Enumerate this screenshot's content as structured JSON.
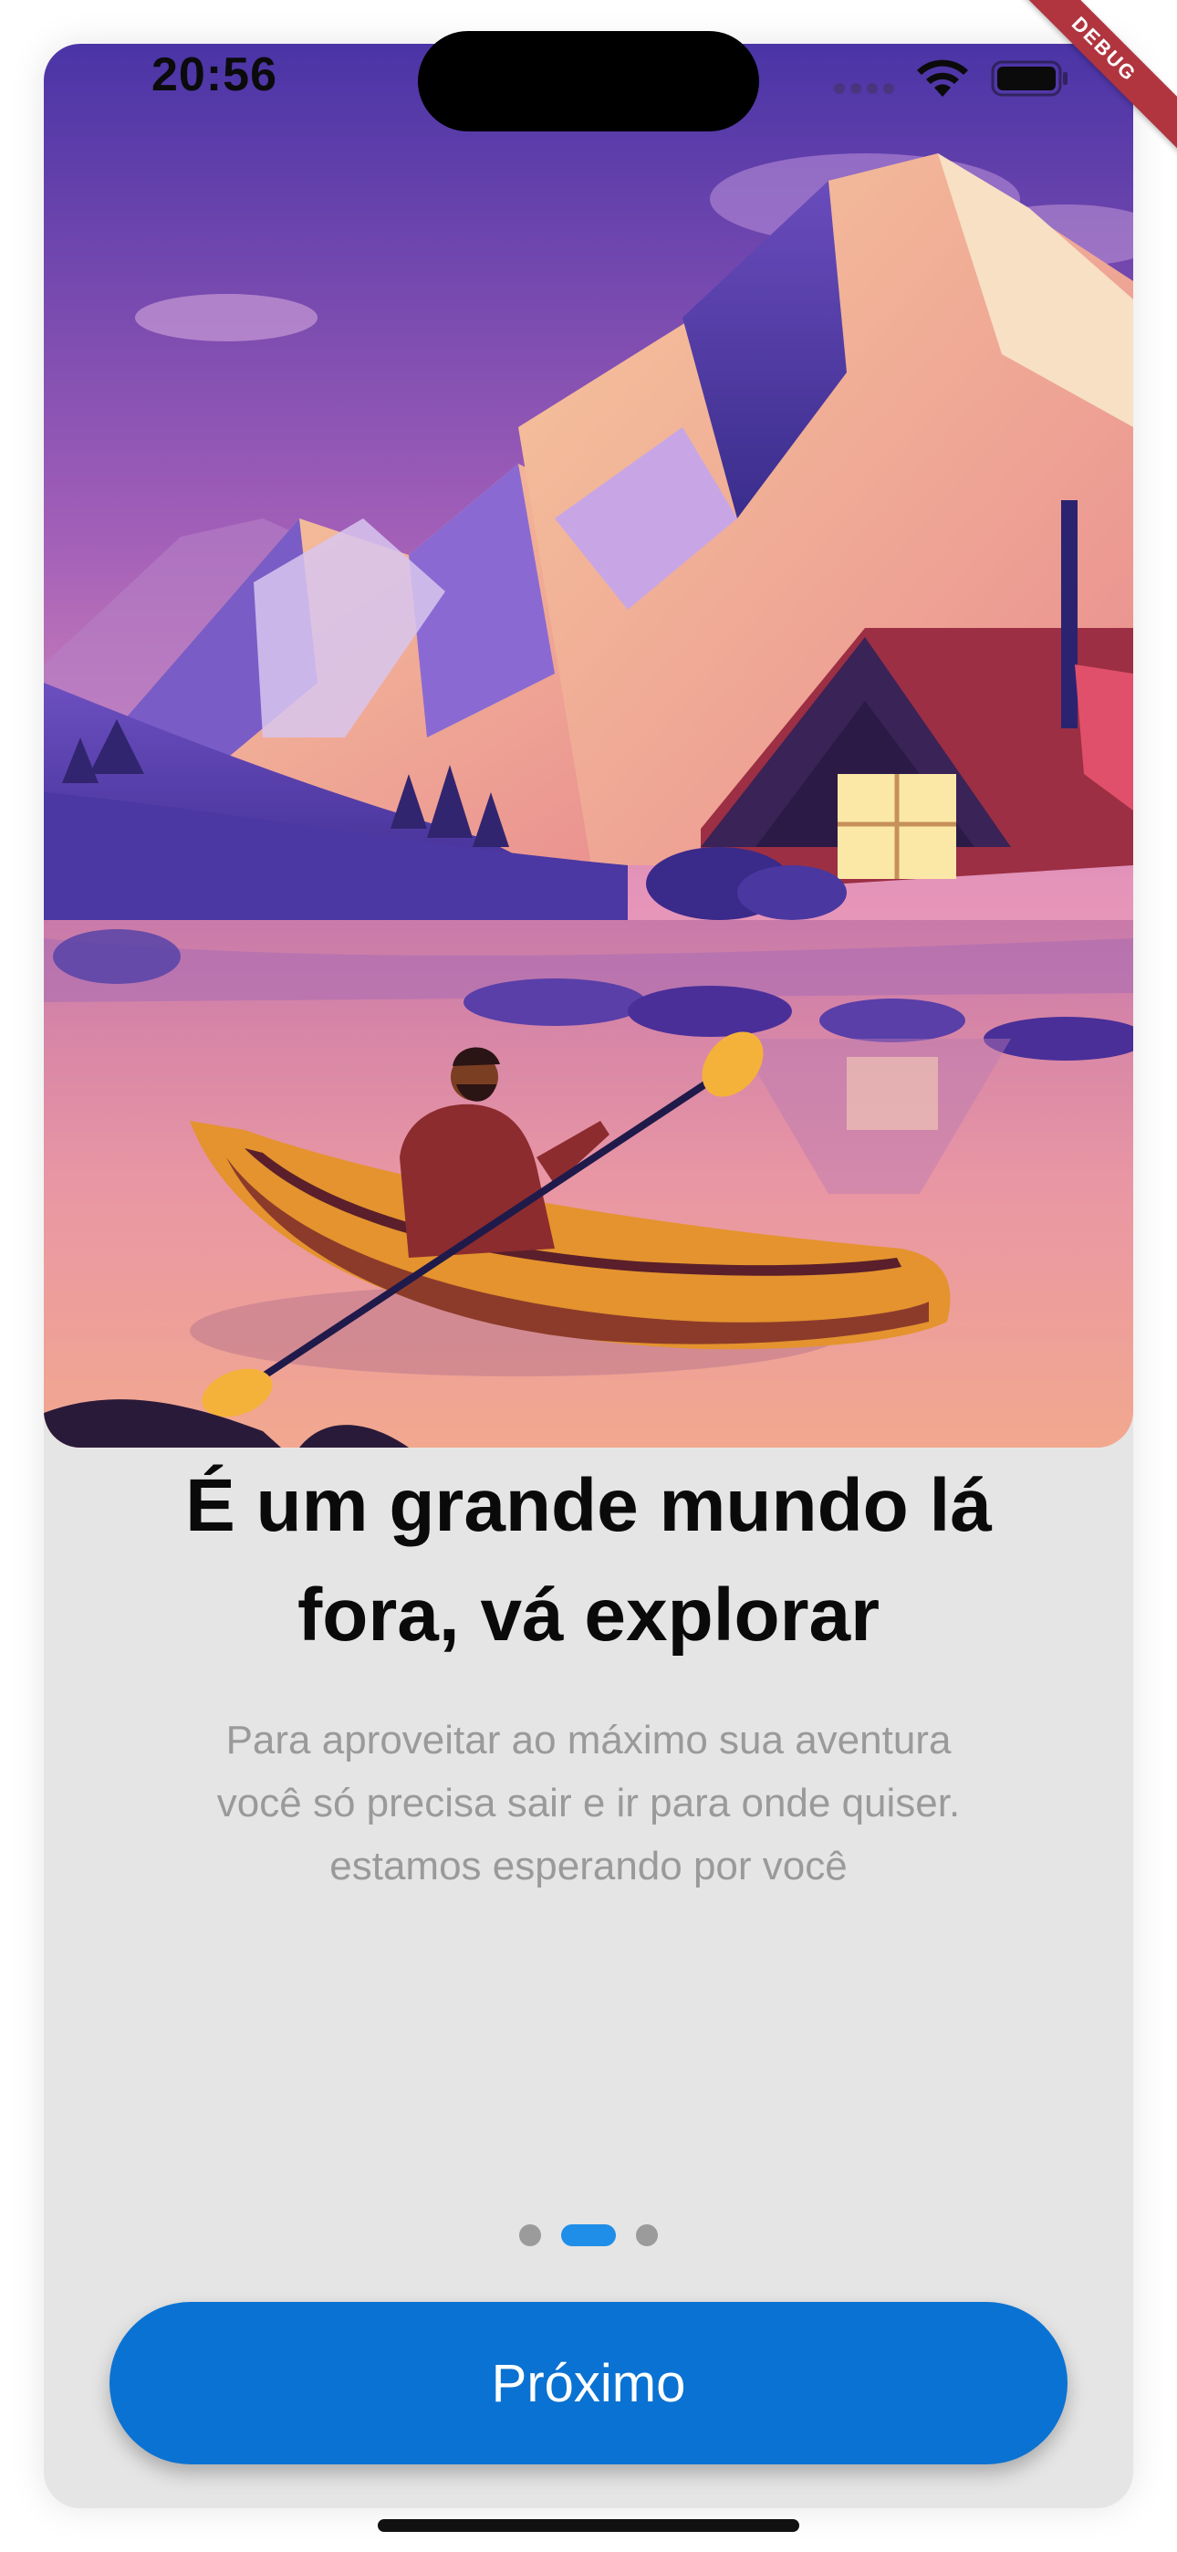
{
  "status_bar": {
    "time": "20:56",
    "icons": [
      "cellular-icon",
      "wifi-icon",
      "battery-icon"
    ]
  },
  "debug_banner": "DEBUG",
  "hero": {
    "illustration": "kayak-lake-mountains-cabin"
  },
  "onboarding": {
    "title": "É um grande mundo lá fora, vá explorar",
    "title_line1": "É um grande mundo lá",
    "title_line2": "fora, vá explorar",
    "subtitle_line1": "Para aproveitar ao máximo sua aventura",
    "subtitle_line2": "você só precisa sair e ir para onde quiser.",
    "subtitle_line3": "estamos esperando por você"
  },
  "pagination": {
    "total": 3,
    "current": 2
  },
  "next_button": {
    "label": "Próximo"
  },
  "colors": {
    "primary": "#0a72d2",
    "active_dot": "#1e8ee8",
    "inactive_dot": "#9b9b9b",
    "background": "#e5e5e5",
    "subtitle_text": "#9a9a9a"
  }
}
